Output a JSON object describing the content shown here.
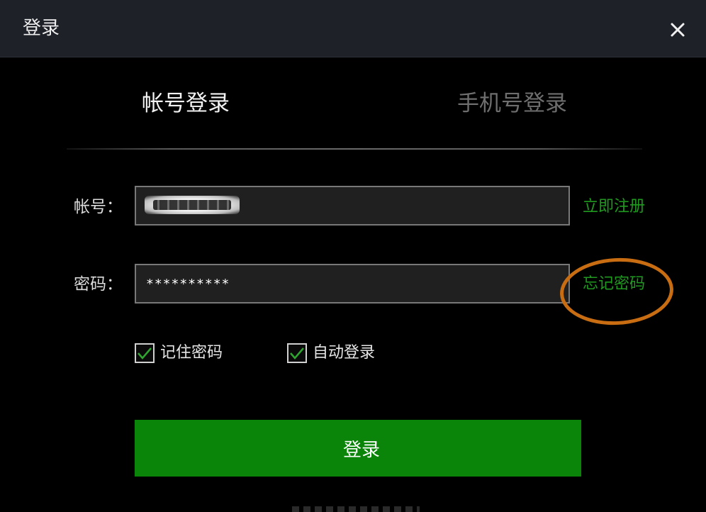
{
  "window": {
    "title": "登录"
  },
  "tabs": [
    {
      "label": "帐号登录",
      "active": true
    },
    {
      "label": "手机号登录",
      "active": false
    }
  ],
  "form": {
    "account_label": "帐号：",
    "password_label": "密码：",
    "password_value": "**********",
    "register_link": "立即注册",
    "forgot_link": "忘记密码"
  },
  "options": {
    "remember_password": {
      "label": "记住密码",
      "checked": true
    },
    "auto_login": {
      "label": "自动登录",
      "checked": true
    }
  },
  "submit": {
    "label": "登录"
  },
  "icons": {
    "close": "close-icon",
    "check": "checkmark-icon"
  },
  "colors": {
    "titlebar": "#1e2128",
    "background": "#000000",
    "accent_green": "#0a850a",
    "link_green": "#1f9a1f",
    "annotation_orange": "#c96d12"
  }
}
